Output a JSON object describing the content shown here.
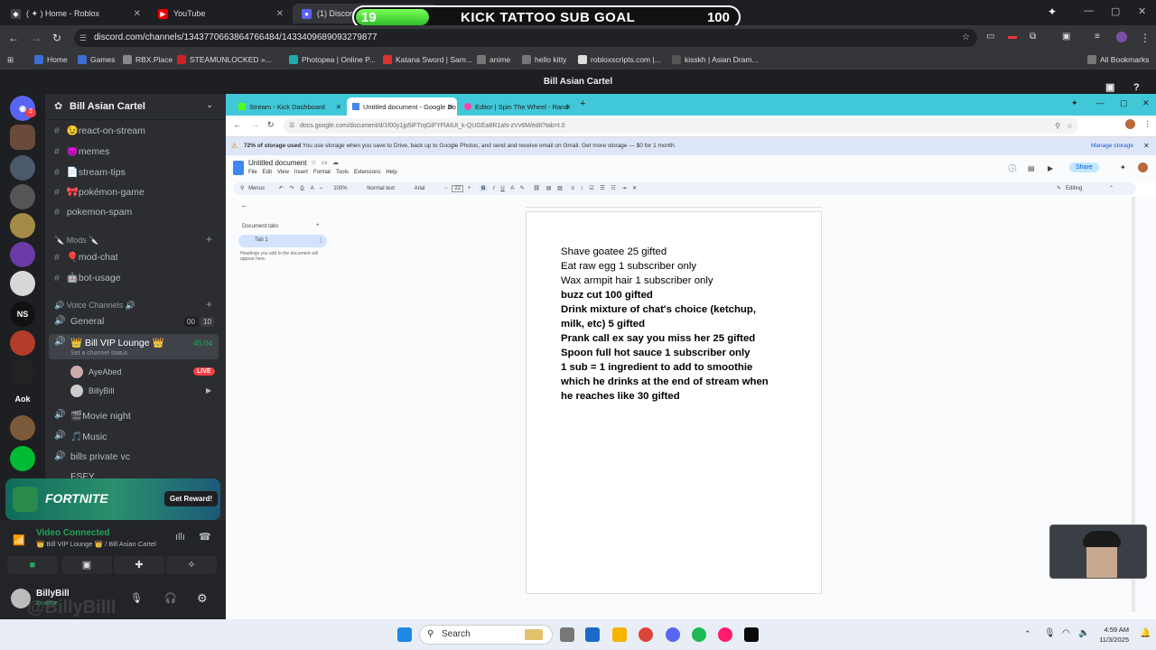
{
  "outer_tabs": [
    {
      "label": "( ✦ ) Home - Roblox",
      "active": false
    },
    {
      "label": "YouTube",
      "active": false
    },
    {
      "label": "(1) Discord | ",
      "active": true
    }
  ],
  "sub_goal": {
    "current": "19",
    "title": "KICK TATTOO SUB GOAL",
    "target": "100",
    "progress": 0.19
  },
  "address_bar": {
    "url": "discord.com/channels/1343770663864766484/1433409689093279877"
  },
  "bookmarks": [
    "Home",
    "Games",
    "RBX.Place",
    "STEAMUNLOCKED »...",
    "Photopea | Online P...",
    "Katana Sword | Sam...",
    "anime",
    "hello kitty",
    "robloxscripts.com |...",
    "kisskh | Asian Dram...",
    "All Bookmarks"
  ],
  "discord": {
    "top_title": "Bill Asian Cartel",
    "guild_name": "Bill Asian Cartel",
    "server_badge": "3",
    "server_labels": {
      "ns": "NS",
      "aok": "Aok"
    },
    "channels": [
      {
        "label": "😉react-on-stream"
      },
      {
        "label": "😈memes"
      },
      {
        "label": "📄stream-tips"
      },
      {
        "label": "🎀pokémon-game"
      },
      {
        "label": "pokemon-spam"
      }
    ],
    "mods_category": "🔪 Mods 🔪",
    "mod_channels": [
      {
        "label": "🎈mod-chat"
      },
      {
        "label": "🤖bot-usage"
      }
    ],
    "voice_category": "🔊 Voice Channels 🔊",
    "general": {
      "label": "General",
      "count_a": "00",
      "count_b": "10"
    },
    "vip": {
      "label": "👑 Bill VIP Lounge 👑",
      "time": "45:04",
      "status": "Set a channel status"
    },
    "members": [
      {
        "name": "AyeAbed",
        "badge": "LIVE"
      },
      {
        "name": "BillyBill"
      }
    ],
    "more_channels": [
      {
        "label": "🎬Movie night"
      },
      {
        "label": "🎵Music"
      },
      {
        "label": "bills private vc"
      },
      {
        "label": "FSFY"
      }
    ],
    "promo": {
      "brand": "FORTNITE",
      "button": "Get Reward!"
    },
    "connection": {
      "title": "Video Connected",
      "subtitle": "👑 Bill VIP Lounge 👑 / Bill Asian Cartel"
    },
    "user": {
      "name": "BillyBill",
      "status": "In voice",
      "watermark": "@BillyBilll"
    }
  },
  "inner_browser": {
    "tabs": [
      "Stream - Kick Dashboard",
      "Untitled document - Google Do",
      "Editor | Spin The Wheel - Rand"
    ],
    "url": "docs.google.com/document/d/1f00y1jp5iFTrqGiFYFlAIUt_k-QUGEa8R1aN-zVv6M/edit?tab=t.0",
    "storage_strong": "72% of storage used",
    "storage_rest": " You use storage when you save to Drive, back up to Google Photos, and send and receive email on Gmail. Get more storage — $0 for 1 month.",
    "storage_action": "Manage storage"
  },
  "gdoc": {
    "title": "Untitled document",
    "menus": [
      "File",
      "Edit",
      "View",
      "Insert",
      "Format",
      "Tools",
      "Extensions",
      "Help"
    ],
    "share": "Share",
    "mode": "Editing",
    "toolbar": {
      "menus": "Menus",
      "zoom": "100%",
      "style": "Normal text",
      "font": "Arial",
      "size": "22"
    },
    "tabs_header": "Document tabs",
    "tab1": "Tab 1",
    "tab_hint": "Headings you add to the document will appear here.",
    "lines": [
      {
        "text": "Shave goatee 25 gifted",
        "bold": false
      },
      {
        "text": "Eat raw egg 1 subscriber only",
        "bold": false
      },
      {
        "text": "Wax armpit hair 1 subscriber only",
        "bold": false
      },
      {
        "text": "buzz cut 100 gifted",
        "bold": true
      },
      {
        "text": " Drink mixture of chat's choice (ketchup,",
        "bold": true
      },
      {
        "text": "milk, etc) 5 gifted",
        "bold": true
      },
      {
        "text": "Prank call ex say you miss her 25 gifted",
        "bold": true
      },
      {
        "text": " Spoon full hot sauce 1 subscriber only",
        "bold": true
      },
      {
        "text": " 1 sub = 1 ingredient to add to smoothie",
        "bold": true
      },
      {
        "text": "which he drinks at the end of stream when",
        "bold": true
      },
      {
        "text": "he reaches like 30 gifted",
        "bold": true
      }
    ]
  },
  "taskbar": {
    "search": "Search",
    "time": "4:59 AM",
    "date": "11/3/2025"
  }
}
